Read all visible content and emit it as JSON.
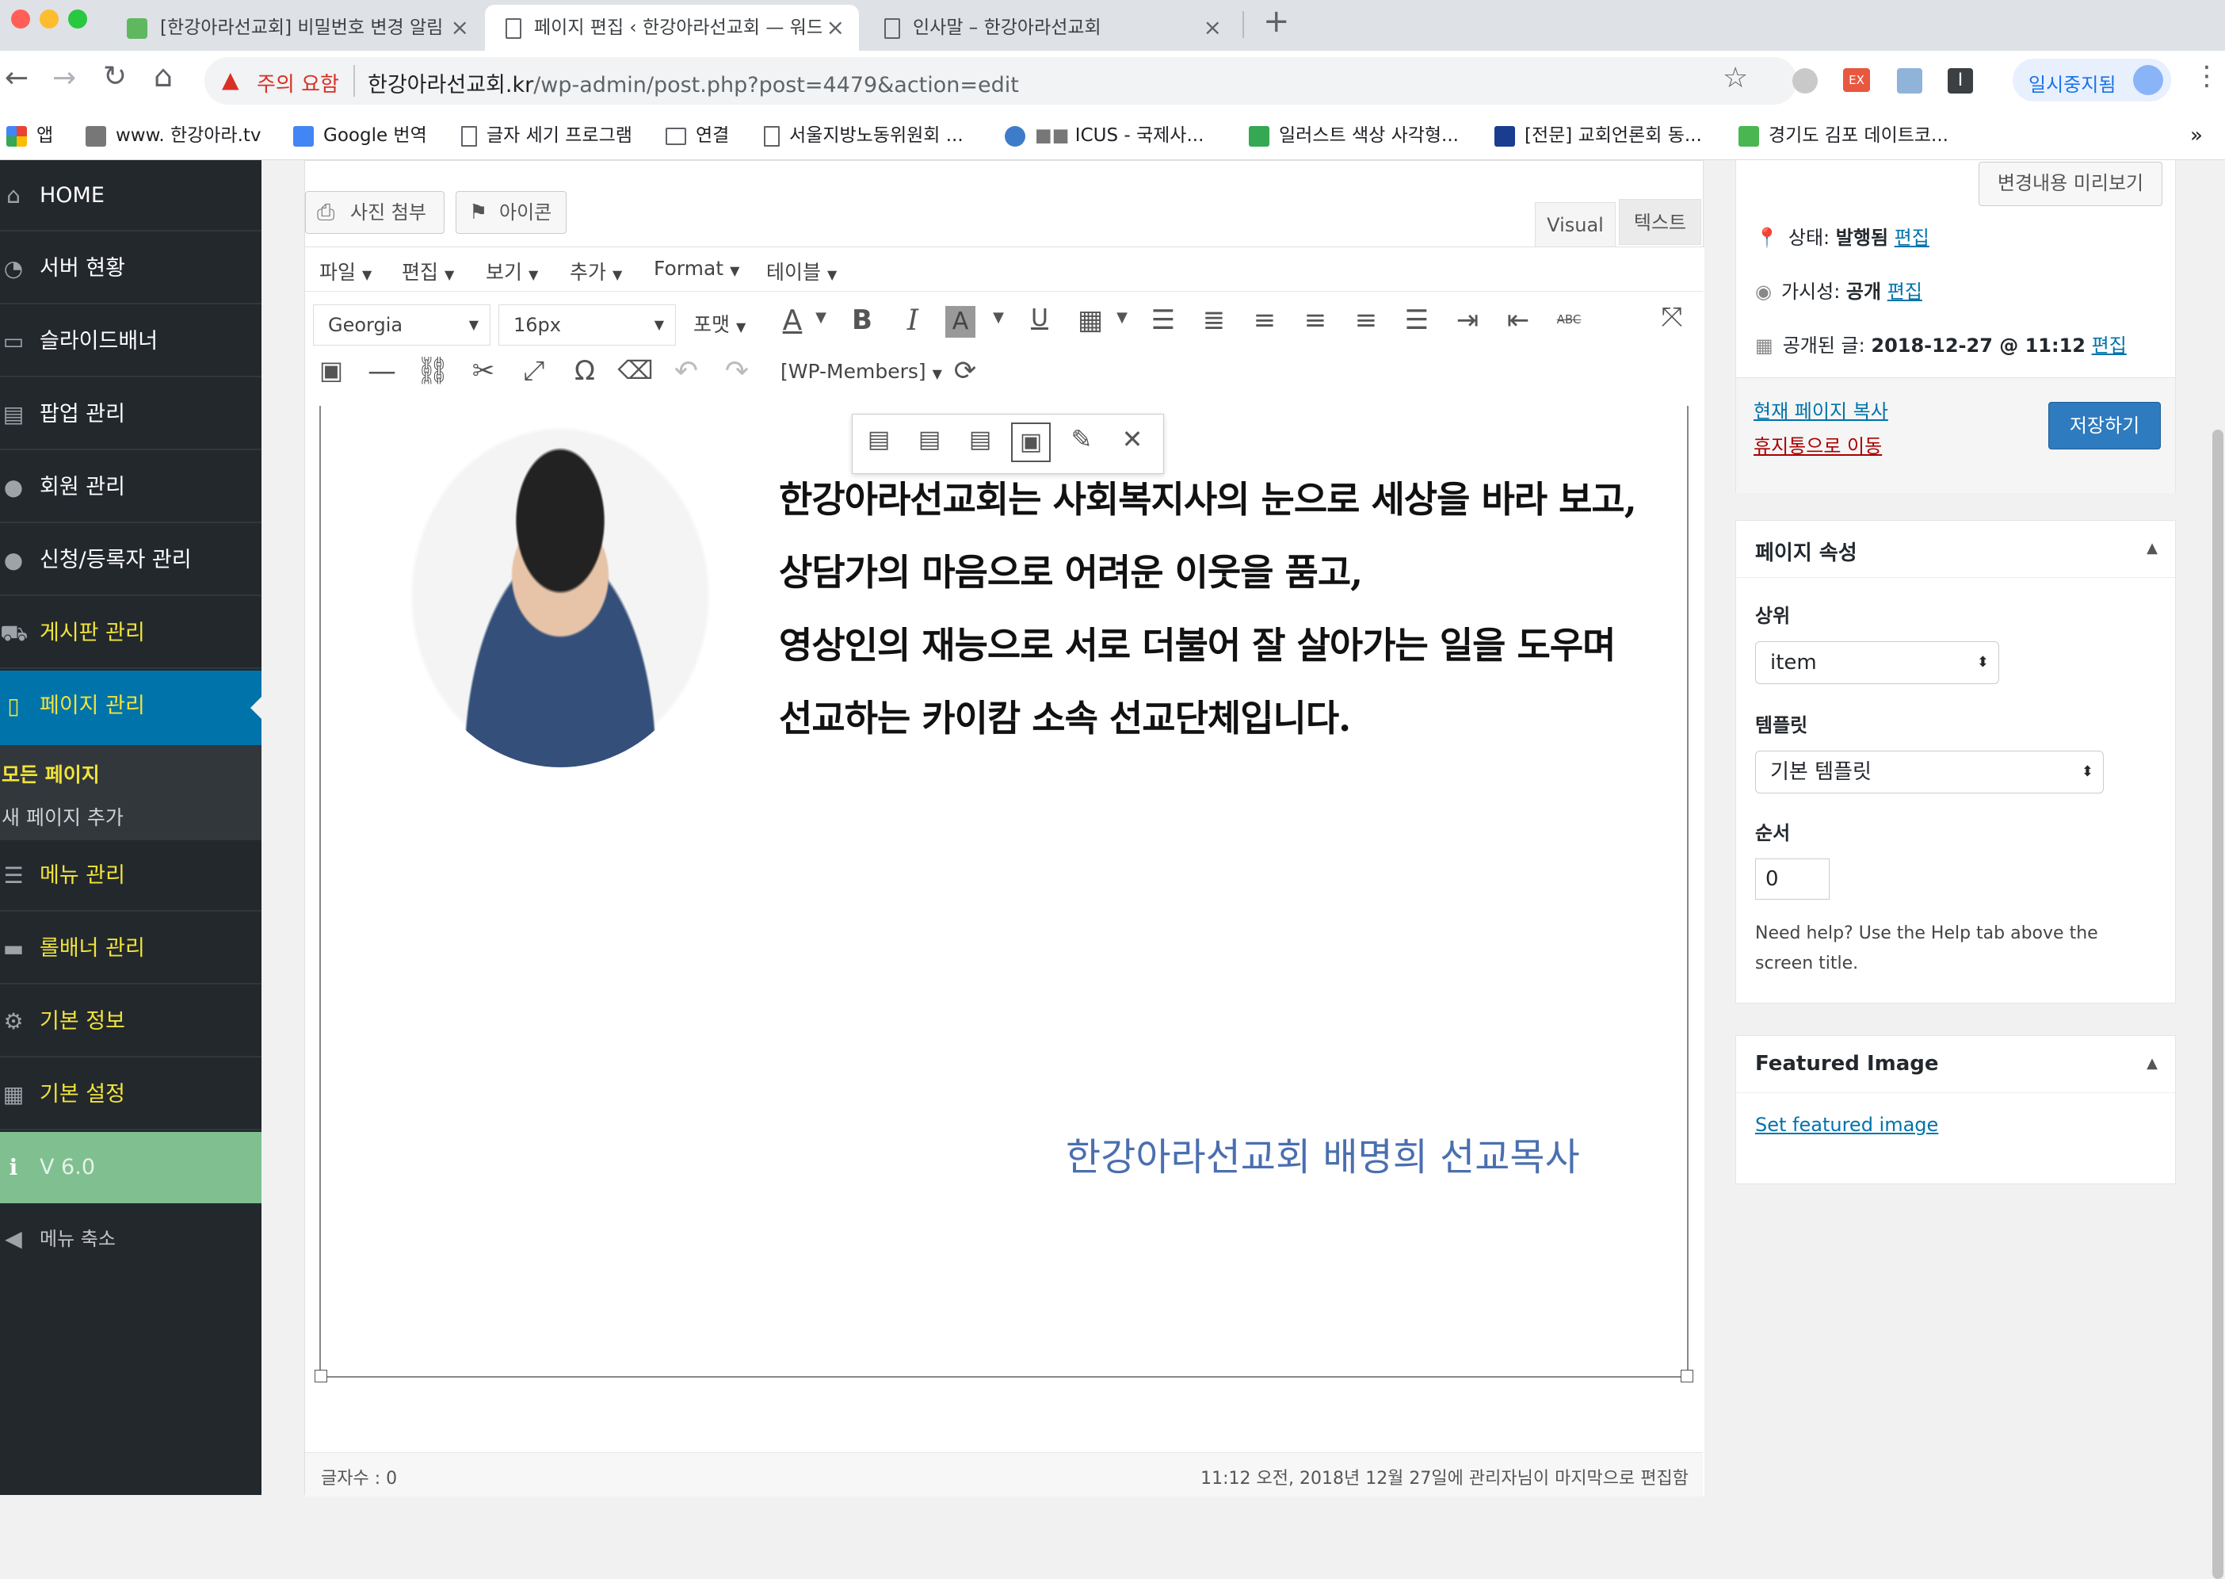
{
  "browser": {
    "tabs": [
      {
        "title": "[한강아라선교회] 비밀번호 변경 알림",
        "active": false
      },
      {
        "title": "페이지 편집 ‹ 한강아라선교회 — 워드",
        "active": true
      },
      {
        "title": "인사말 – 한강아라선교회",
        "active": false
      }
    ],
    "security_warning": "주의 요함",
    "url_domain": "한강아라선교회.kr",
    "url_path": "/wp-admin/post.php?post=4479&action=edit",
    "profile_label": "일시중지됨",
    "bookmarks": [
      "앱",
      "www. 한강아라.tv",
      "Google 번역",
      "글자 세기 프로그램",
      "연결",
      "서울지방노동위원회 ...",
      "ICUS - 국제사...",
      "일러스트 색상 사각형...",
      "[전문] 교회언론회 동...",
      "경기도 김포 데이트코..."
    ],
    "bookmarks_more": "»"
  },
  "sidebar": {
    "items": [
      {
        "label": "HOME",
        "icon": "home-icon",
        "glyph": "⌂"
      },
      {
        "label": "서버 현황",
        "icon": "dashboard-icon",
        "glyph": "◔"
      },
      {
        "label": "슬라이드배너",
        "icon": "slides-icon",
        "glyph": "▭"
      },
      {
        "label": "팝업 관리",
        "icon": "popup-icon",
        "glyph": "▤"
      },
      {
        "label": "회원 관리",
        "icon": "user-icon",
        "glyph": "●"
      },
      {
        "label": "신청/등록자 관리",
        "icon": "user-icon",
        "glyph": "●"
      },
      {
        "label": "게시판 관리",
        "icon": "cart-icon",
        "glyph": "⛟"
      },
      {
        "label": "페이지 관리",
        "icon": "pages-icon",
        "glyph": "▯"
      },
      {
        "label": "메뉴 관리",
        "icon": "list-icon",
        "glyph": "☰"
      },
      {
        "label": "롤배너 관리",
        "icon": "banner-icon",
        "glyph": "▬"
      },
      {
        "label": "기본 정보",
        "icon": "gear-icon",
        "glyph": "⚙"
      },
      {
        "label": "기본 설정",
        "icon": "grid-icon",
        "glyph": "▦"
      },
      {
        "label": "V 6.0",
        "icon": "info-icon",
        "glyph": "ℹ"
      },
      {
        "label": "메뉴 축소",
        "icon": "collapse-icon",
        "glyph": "◀"
      }
    ],
    "submenu": [
      "모든 페이지",
      "새 페이지 추가"
    ]
  },
  "editor": {
    "add_media": "사진 첨부",
    "icon_button": "아이콘",
    "tab_visual": "Visual",
    "tab_text": "텍스트",
    "menubar": [
      "파일",
      "편집",
      "보기",
      "추가",
      "Format",
      "테이블"
    ],
    "font_family": "Georgia",
    "font_size": "16px",
    "format_label": "포맷",
    "shortcode_label": "[WP-Members]",
    "content_lines": [
      "한강아라선교회는 사회복지사의 눈으로 세상을 바라 보고,",
      "상담가의 마음으로 어려운 이웃을 품고,",
      "영상인의 재능으로 서로 더불어 잘 살아가는 일을 도우며",
      "선교하는 카이캄 소속 선교단체입니다."
    ],
    "signature": "한강아라선교회 배명희 선교목사",
    "word_count": "글자수 : 0",
    "last_edited": "11:12 오전, 2018년 12월 27일에 관리자님이 마지막으로 편집함"
  },
  "publish": {
    "preview_button": "변경내용 미리보기",
    "status_label": "상태:",
    "status_value": "발행됨",
    "visibility_label": "가시성:",
    "visibility_value": "공개",
    "published_label": "공개된 글:",
    "published_value": "2018-12-27 @ 11:12",
    "edit_link": "편집",
    "copy_link": "현재 페이지 복사",
    "trash_link": "휴지통으로 이동",
    "save_button": "저장하기"
  },
  "page_attributes": {
    "title": "페이지 속성",
    "parent_label": "상위",
    "parent_value": "item",
    "template_label": "템플릿",
    "template_value": "기본 템플릿",
    "order_label": "순서",
    "order_value": "0",
    "help_text": "Need help? Use the Help tab above the screen title."
  },
  "featured_image": {
    "title": "Featured Image",
    "set_link": "Set featured image"
  },
  "colors": {
    "sidebar_bg": "#23282d",
    "active_menu": "#0073aa",
    "version_bg": "#7fbf90",
    "save_button": "#2e7bbf",
    "trash_red": "#a00",
    "signature_blue": "#4a6fb0"
  }
}
